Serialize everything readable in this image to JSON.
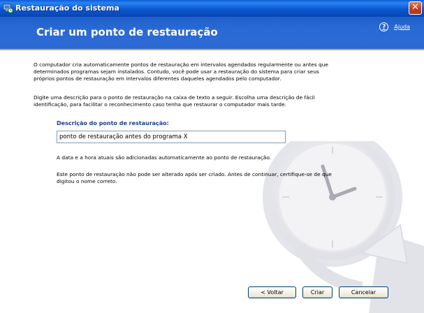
{
  "window": {
    "title": "Restauração do sistema",
    "close_label": "✕"
  },
  "banner": {
    "page_title": "Criar um ponto de restauração",
    "help_label": "Ajuda",
    "help_icon": "?"
  },
  "content": {
    "intro": "O computador cria automaticamente pontos de restauração em intervalos agendados regularmente ou antes que determinados programas sejam instalados. Contudo, você pode usar a restauração do sistema para criar seus próprios pontos de restauração em intervalos diferentes daqueles agendados pelo computador.",
    "instruction": "Digite uma descrição para o ponto de restauração na caixa de texto a seguir. Escolha uma descrição de fácil identificação, para facilitar o reconhecimento caso tenha que restaurar o computador mais tarde.",
    "field_label": "Descrição do ponto de restauração:",
    "field_value": "ponto de restauração antes do programa X",
    "note_datetime": "A data e a hora atuais são adicionadas automaticamente ao ponto de restauração.",
    "note_warning": "Este ponto de restauração não pode ser alterado após ser criado. Antes de continuar, certifique-se de que digitou o nome correto."
  },
  "buttons": {
    "back": "< Voltar",
    "create": "Criar",
    "cancel": "Cancelar"
  },
  "colors": {
    "titlebar": "#0a57d0",
    "banner": "#2a6ad6",
    "accent_line": "#f0a040",
    "field_label": "#1c3c8c"
  }
}
